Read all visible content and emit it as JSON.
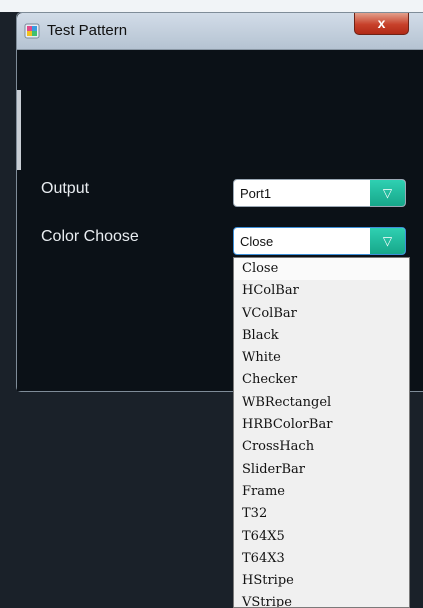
{
  "window": {
    "title": "Test Pattern",
    "close_glyph": "x"
  },
  "form": {
    "output_label": "Output",
    "output_value": "Port1",
    "color_label": "Color Choose",
    "color_value": "Close",
    "arrow_glyph": "▽"
  },
  "dropdown": {
    "options": [
      "Close",
      "HColBar",
      "VColBar",
      "Black",
      "White",
      "Checker",
      "WBRectangel",
      "HRBColorBar",
      "CrossHach",
      "SliderBar",
      "Frame",
      "T32",
      "T64X5",
      "T64X3",
      "HStripe",
      "VStripe"
    ]
  },
  "icons": {
    "app": "app-icon",
    "close": "close-icon",
    "dropdown": "chevron-down-icon"
  },
  "colors": {
    "accent": "#1fb89a",
    "close": "#c7402a",
    "background": "#0b1117"
  }
}
